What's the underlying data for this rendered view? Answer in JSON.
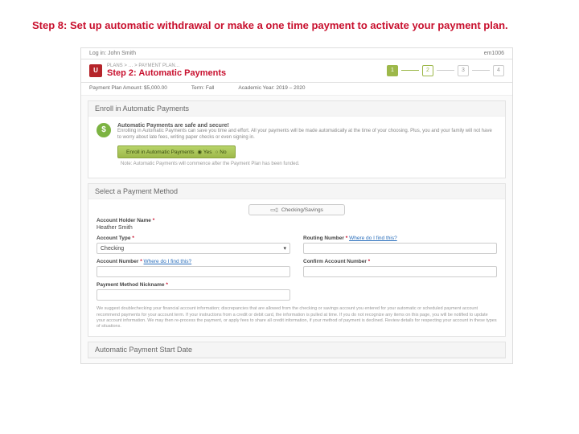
{
  "doc": {
    "title": "Step 8: Set up automatic withdrawal or make a one time payment to activate your payment plan."
  },
  "header": {
    "user_prefix": "Log in:",
    "user_name": "John Smith",
    "user_id": "em1006"
  },
  "step_banner": {
    "breadcrumb": "PLANS > … > PAYMENT PLAN…",
    "title": "Step 2: Automatic Payments",
    "steps": {
      "one": "1",
      "two": "2",
      "three": "3",
      "four": "4"
    }
  },
  "info_bar": {
    "amount_label": "Payment Plan Amount:",
    "amount_value": "$5,000.00",
    "term_label": "Term:",
    "term_value": "Fall",
    "year_label": "Academic Year:",
    "year_value": "2019 – 2020"
  },
  "enroll_card": {
    "header": "Enroll in Automatic Payments",
    "headline": "Automatic Payments are safe and secure!",
    "body": "Enrolling in Automatic Payments can save you time and effort. All your payments will be made automatically at the time of your choosing. Plus, you and your family will not have to worry about late fees, writing paper checks or even signing in.",
    "button": "Enroll in Automatic Payments",
    "toggle_yes": "Yes",
    "toggle_no": "No",
    "note": "Note: Automatic Payments will commence after the Payment Plan has been funded."
  },
  "method_card": {
    "header": "Select a Payment Method",
    "tab": "Checking/Savings",
    "holder_label": "Account Holder Name",
    "holder_value": "Heather Smith",
    "type_label": "Account Type",
    "type_value": "Checking",
    "routing_label": "Routing Number",
    "routing_link": "Where do I find this?",
    "acct_label": "Account Number",
    "acct_link": "Where do I find this?",
    "confirm_label": "Confirm Account Number",
    "nickname_label": "Payment Method Nickname",
    "disclaimer": "We suggest doublechecking your financial account information; discrepancies that are allowed from the checking or savings account you entered for your automatic or scheduled payment account recommend payments for your account term. If your instructions from a credit or debit card, the information is pulled at time. If you do not recognize any items on this page, you will be notified to update your account information. We may then re-process the payment, or apply fees to share all credit information, if your method of payment is declined. Review details for respecting your account in these types of situations."
  },
  "start_card": {
    "header": "Automatic Payment Start Date"
  }
}
